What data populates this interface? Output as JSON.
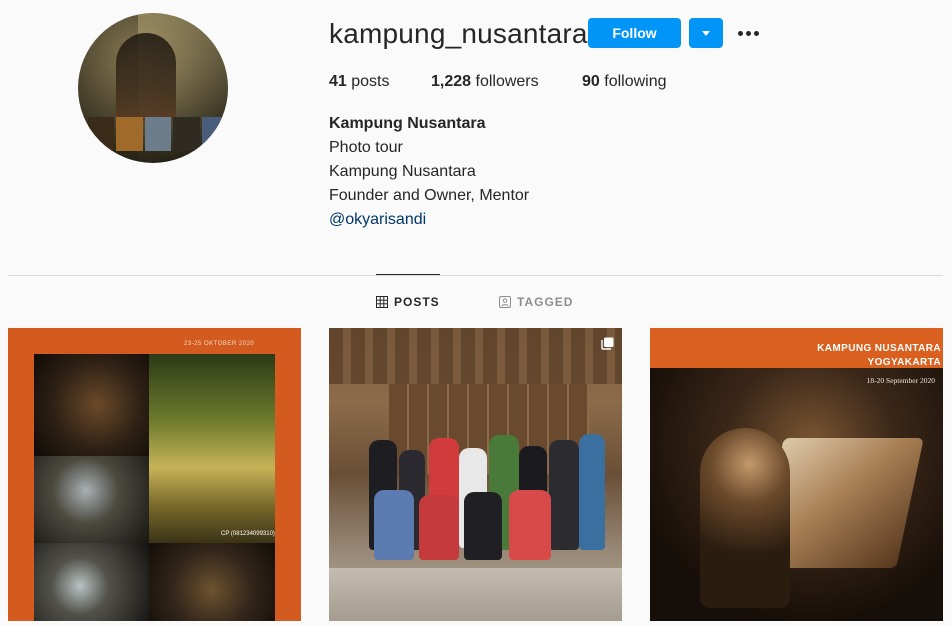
{
  "profile": {
    "username": "kampung_nusantara",
    "follow_label": "Follow",
    "dropdown_icon": "caret-down-icon",
    "more_icon": "more-options-icon",
    "accent_color": "#0095f6",
    "stats": {
      "posts_count": "41",
      "posts_label": "posts",
      "followers_count": "1,228",
      "followers_label": "followers",
      "following_count": "90",
      "following_label": "following"
    },
    "bio": {
      "name": "Kampung Nusantara",
      "category": "Photo tour",
      "line1": "Kampung Nusantara",
      "line2": "Founder and Owner, Mentor",
      "mention": "@okyarisandi"
    }
  },
  "tabs": [
    {
      "label": "POSTS",
      "icon": "grid-icon",
      "active": true
    },
    {
      "label": "TAGGED",
      "icon": "tagged-icon",
      "active": false
    }
  ],
  "posts": [
    {
      "header_text": "23-25 OKTOBER 2020",
      "contact_text": "CP (081234099310)"
    },
    {
      "multi_icon": "carousel-icon"
    },
    {
      "title_line1": "KAMPUNG NUSANTARA",
      "title_line2": "YOGYAKARTA",
      "date_text": "18-20 September 2020"
    }
  ]
}
